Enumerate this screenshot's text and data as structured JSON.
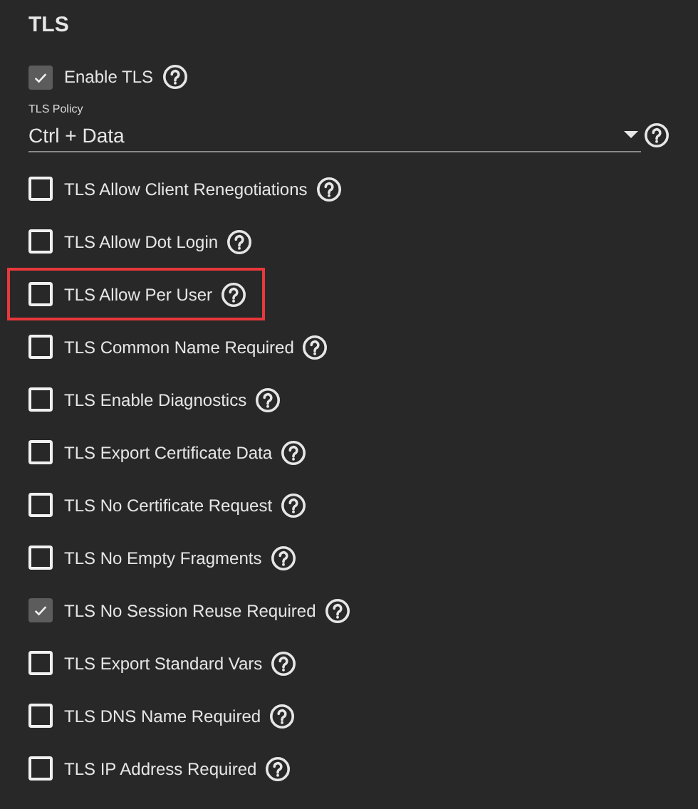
{
  "section": {
    "title": "TLS"
  },
  "enable": {
    "label": "Enable TLS",
    "checked": true
  },
  "policy": {
    "label": "TLS Policy",
    "value": "Ctrl + Data"
  },
  "options": [
    {
      "label": "TLS Allow Client Renegotiations",
      "checked": false,
      "highlighted": false
    },
    {
      "label": "TLS Allow Dot Login",
      "checked": false,
      "highlighted": false
    },
    {
      "label": "TLS Allow Per User",
      "checked": false,
      "highlighted": true
    },
    {
      "label": "TLS Common Name Required",
      "checked": false,
      "highlighted": false
    },
    {
      "label": "TLS Enable Diagnostics",
      "checked": false,
      "highlighted": false
    },
    {
      "label": "TLS Export Certificate Data",
      "checked": false,
      "highlighted": false
    },
    {
      "label": "TLS No Certificate Request",
      "checked": false,
      "highlighted": false
    },
    {
      "label": "TLS No Empty Fragments",
      "checked": false,
      "highlighted": false
    },
    {
      "label": "TLS No Session Reuse Required",
      "checked": true,
      "highlighted": false
    },
    {
      "label": "TLS Export Standard Vars",
      "checked": false,
      "highlighted": false
    },
    {
      "label": "TLS DNS Name Required",
      "checked": false,
      "highlighted": false
    },
    {
      "label": "TLS IP Address Required",
      "checked": false,
      "highlighted": false
    }
  ]
}
